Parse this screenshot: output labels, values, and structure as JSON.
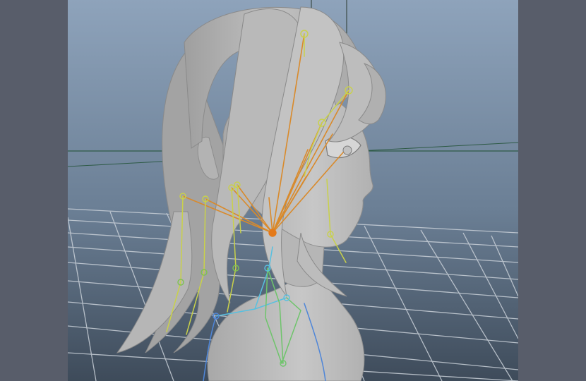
{
  "window": {
    "title": ""
  },
  "viewport": {
    "background_top": "#8ea3bb",
    "background_bottom": "#3e4b5a",
    "grid_color": "#c9d0d8",
    "model_color": "#b9b9b9"
  },
  "joints": {
    "hair_chain_color": "#d98a2b",
    "side_chain_color": "#c9d14a",
    "neck_chain_color": "#57c0e0",
    "spine_chain_color": "#5aa0e0",
    "root_color": "#e47a1a"
  }
}
